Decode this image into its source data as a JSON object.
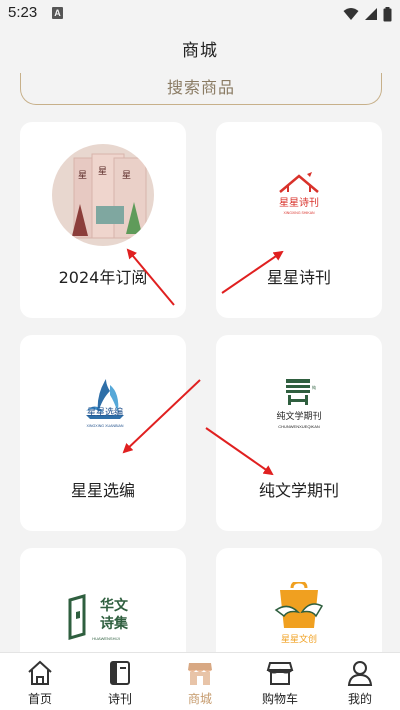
{
  "status_bar": {
    "time": "5:23",
    "badge": "A"
  },
  "header": {
    "title": "商城"
  },
  "search": {
    "placeholder": "搜索商品"
  },
  "products": [
    {
      "label": "2024年订阅",
      "icon": "magazine-cover-image"
    },
    {
      "label": "星星诗刊",
      "icon": "xingxing-shikan-logo",
      "logo_text": "星星诗刊",
      "logo_sub": "XINGXING SHIKAN"
    },
    {
      "label": "星星选编",
      "icon": "xingxing-xuanbian-logo",
      "logo_text": "星星选编",
      "logo_sub": "XINGXING XUANBIAN"
    },
    {
      "label": "纯文学期刊",
      "icon": "chunwenxue-qikan-logo",
      "logo_text": "纯文学期刊",
      "logo_sub": "CHUNWENXUEQIKAN"
    },
    {
      "label": "",
      "icon": "huawen-shiji-logo",
      "logo_text_1": "华文",
      "logo_text_2": "诗集",
      "logo_sub": "HUAWENSHIJI"
    },
    {
      "label": "",
      "icon": "xingxing-wenchuang-logo",
      "logo_text": "星星文创"
    }
  ],
  "nav": [
    {
      "label": "首页",
      "icon": "home-icon"
    },
    {
      "label": "诗刊",
      "icon": "book-icon"
    },
    {
      "label": "商城",
      "icon": "store-icon",
      "active": true
    },
    {
      "label": "购物车",
      "icon": "cart-icon"
    },
    {
      "label": "我的",
      "icon": "user-icon"
    }
  ],
  "colors": {
    "accent": "#c59a6c",
    "annotation_arrow": "#e02020",
    "logo_red": "#d9322b",
    "logo_green": "#2f5f3f",
    "logo_blue": "#2f6fa8",
    "logo_orange": "#f0a020"
  }
}
